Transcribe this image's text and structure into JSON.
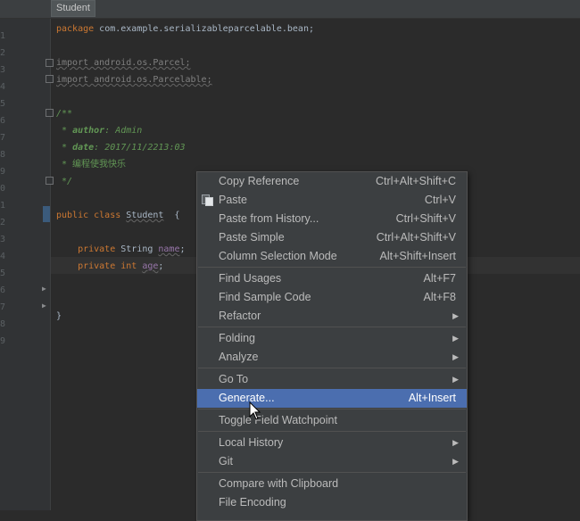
{
  "editor": {
    "tab_label": "Student",
    "gutter_numbers": [
      "1",
      "2",
      "3",
      "4",
      "5",
      "6",
      "7",
      "8",
      "9",
      "0",
      "1",
      "2",
      "3",
      "4",
      "5",
      "6",
      "7",
      "8",
      "9"
    ],
    "code": {
      "package_kw": "package",
      "package_name": " com.example.serializableparcelable.bean;",
      "import1": "import android.os.Parcel;",
      "import2": "import android.os.Parcelable;",
      "javadoc_open": "/**",
      "author_prefix": " * ",
      "author_tag": "author",
      "author_value": ": Admin",
      "date_prefix": " * ",
      "date_tag": "date",
      "date_value": ": 2017/11/2213:03",
      "desc": " * 编程使我快乐",
      "javadoc_close": " */",
      "class_kw": "public class",
      "class_name": "Student",
      "class_brace": "  {",
      "field1_kw": "    private",
      "field1_type": " String ",
      "field1_name": "name",
      "field1_semi": ";",
      "field2_kw": "    private int",
      "field2_name": "age",
      "field2_semi": ";",
      "closing_brace": "}"
    }
  },
  "context_menu": {
    "items": [
      {
        "label": "Copy Reference",
        "shortcut": "Ctrl+Alt+Shift+C"
      },
      {
        "label": "Paste",
        "shortcut": "Ctrl+V",
        "icon": "paste-icon"
      },
      {
        "label": "Paste from History...",
        "shortcut": "Ctrl+Shift+V"
      },
      {
        "label": "Paste Simple",
        "shortcut": "Ctrl+Alt+Shift+V"
      },
      {
        "label": "Column Selection Mode",
        "shortcut": "Alt+Shift+Insert"
      },
      {
        "label": "Find Usages",
        "shortcut": "Alt+F7"
      },
      {
        "label": "Find Sample Code",
        "shortcut": "Alt+F8"
      },
      {
        "label": "Refactor",
        "submenu": true
      },
      {
        "label": "Folding",
        "submenu": true
      },
      {
        "label": "Analyze",
        "submenu": true
      },
      {
        "label": "Go To",
        "submenu": true
      },
      {
        "label": "Generate...",
        "shortcut": "Alt+Insert",
        "selected": true
      },
      {
        "label": "Toggle Field Watchpoint"
      },
      {
        "label": "Local History",
        "submenu": true
      },
      {
        "label": "Git",
        "submenu": true
      },
      {
        "label": "Compare with Clipboard"
      },
      {
        "label": "File Encoding"
      }
    ],
    "submenu_glyph": "▶"
  },
  "colors": {
    "editor_bg": "#2b2b2b",
    "keyword": "#cc7832",
    "comment": "#629755",
    "field": "#9876aa",
    "menu_bg": "#3c3f41",
    "selection": "#4b6eaf"
  }
}
